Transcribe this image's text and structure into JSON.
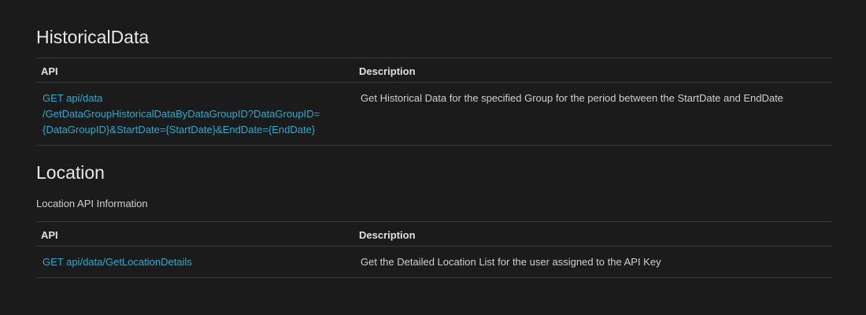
{
  "historical": {
    "title": "HistoricalData",
    "headers": {
      "api": "API",
      "description": "Description"
    },
    "rows": [
      {
        "api_lines": [
          "GET api/data",
          "/GetDataGroupHistoricalDataByDataGroupID?DataGroupID=",
          "{DataGroupID}&StartDate={StartDate}&EndDate={EndDate}"
        ],
        "description": "Get Historical Data for the specified Group for the period between the StartDate and EndDate"
      }
    ]
  },
  "location": {
    "title": "Location",
    "subtitle": "Location API Information",
    "headers": {
      "api": "API",
      "description": "Description"
    },
    "rows": [
      {
        "api": "GET api/data/GetLocationDetails",
        "description": "Get the Detailed Location List for the user assigned to the API Key"
      }
    ]
  },
  "colors": {
    "background": "#1c1b1c",
    "link": "#2fa8c9",
    "border": "#3a3a3a"
  }
}
